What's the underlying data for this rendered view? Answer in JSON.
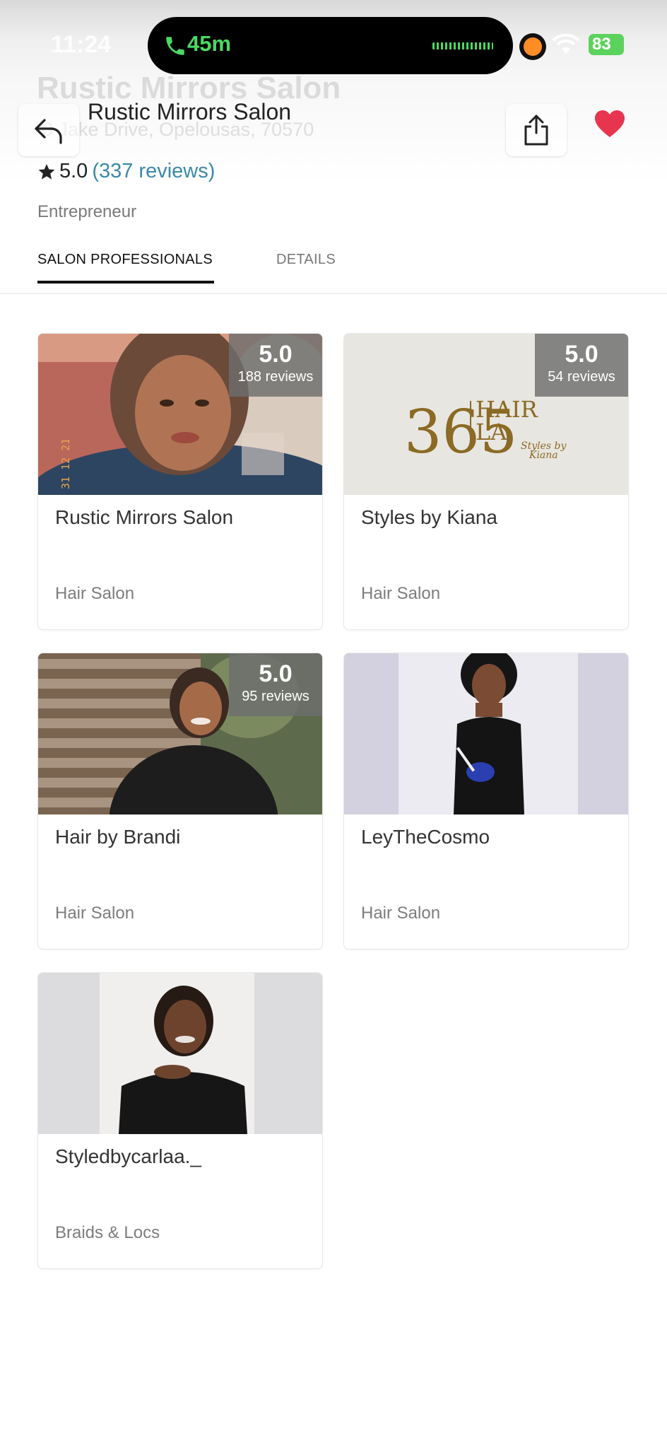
{
  "status_bar": {
    "time": "11:24",
    "call_duration": "45m",
    "battery": "83"
  },
  "hero": {
    "ghost_title": "Rustic Mirrors Salon",
    "ghost_address": "3 Jake Drive, Opelousas, 70570"
  },
  "header": {
    "title": "Rustic Mirrors Salon",
    "favorite_color": "#e8354f"
  },
  "salon": {
    "rating": "5.0",
    "reviews": "(337 reviews)",
    "category": "Entrepreneur"
  },
  "tabs": [
    {
      "label": "SALON PROFESSIONALS",
      "active": true
    },
    {
      "label": "DETAILS",
      "active": false
    }
  ],
  "professionals": [
    {
      "name": "Rustic Mirrors Salon",
      "type": "Hair Salon",
      "rating": "5.0",
      "reviews": "188 reviews"
    },
    {
      "name": "Styles by Kiana",
      "type": "Hair Salon",
      "rating": "5.0",
      "reviews": "54 reviews",
      "logo_text": {
        "big": "365",
        "right": "HAIR",
        "right2": "LA",
        "script": "Styles by",
        "script2": "Kiana"
      }
    },
    {
      "name": "Hair by Brandi",
      "type": "Hair Salon",
      "rating": "5.0",
      "reviews": "95 reviews"
    },
    {
      "name": "LeyTheCosmo",
      "type": "Hair Salon"
    },
    {
      "name": "Styledbycarlaa._",
      "type": "Braids & Locs"
    }
  ],
  "photo_stamp": "31 12 21"
}
